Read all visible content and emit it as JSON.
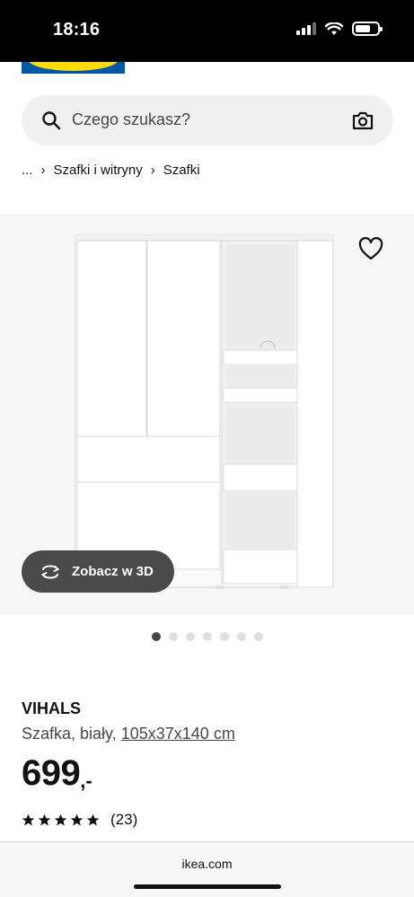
{
  "status_bar": {
    "time": "18:16",
    "battery_level": 0.7,
    "icons": [
      "signal-icon",
      "wifi-icon",
      "battery-icon"
    ]
  },
  "search": {
    "placeholder": "Czego szukasz?"
  },
  "breadcrumb": {
    "ellipsis": "...",
    "items": [
      "Szafki i witryny",
      "Szafki"
    ]
  },
  "product": {
    "name": "VIHALS",
    "description": "Szafka, biały,",
    "dimensions": "105x37x140 cm",
    "price": "699",
    "price_suffix": ",-",
    "rating": 5,
    "review_count": "(23)"
  },
  "view3d": {
    "label": "Zobacz w 3D"
  },
  "carousel": {
    "total": 7,
    "active_index": 0
  },
  "browser": {
    "url": "ikea.com"
  },
  "colors": {
    "brand_blue": "#0058a3",
    "brand_yellow": "#ffdb00",
    "button_dark": "#4a4a4a"
  }
}
